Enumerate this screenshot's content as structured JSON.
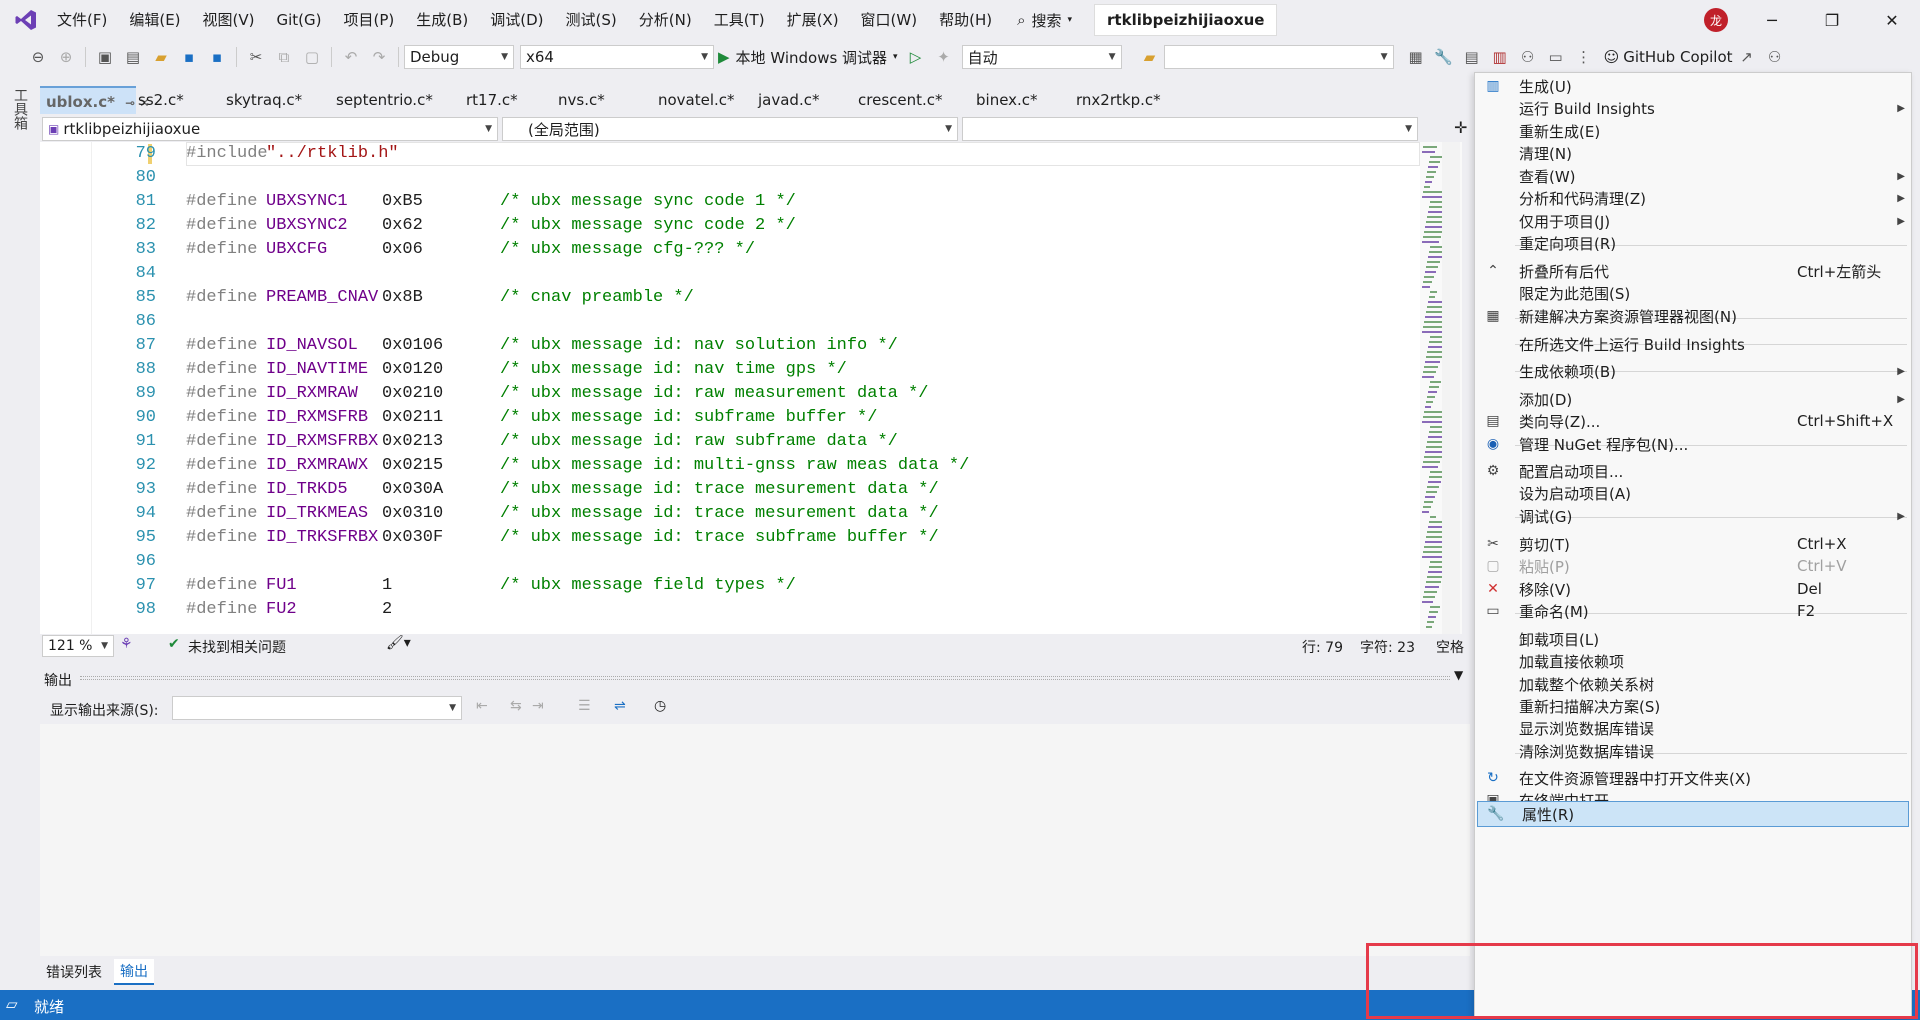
{
  "menubar": {
    "items": [
      "文件(F)",
      "编辑(E)",
      "视图(V)",
      "Git(G)",
      "项目(P)",
      "生成(B)",
      "调试(D)",
      "测试(S)",
      "分析(N)",
      "工具(T)",
      "扩展(X)",
      "窗口(W)",
      "帮助(H)"
    ],
    "search_label": "搜索",
    "solution_name": "rtklibpeizhijiaoxue",
    "avatar": "龙"
  },
  "toolbar": {
    "config": "Debug",
    "platform": "x64",
    "run_label": "本地 Windows 调试器",
    "auto_label": "自动",
    "copilot_label": "GitHub Copilot"
  },
  "left_rail": {
    "label": "工具箱"
  },
  "tabs": [
    "ublox.c*",
    "ss2.c*",
    "skytraq.c*",
    "septentrio.c*",
    "rt17.c*",
    "nvs.c*",
    "novatel.c*",
    "javad.c*",
    "crescent.c*",
    "binex.c*",
    "rnx2rtkp.c*"
  ],
  "nav": {
    "project": "rtklibpeizhijiaoxue",
    "scope": "(全局范围)",
    "member": ""
  },
  "code_lines": [
    {
      "n": "79",
      "kw": "#include",
      "mac": "",
      "val": "",
      "str": "\"../rtklib.h\"",
      "cm": ""
    },
    {
      "n": "80",
      "kw": "",
      "mac": "",
      "val": "",
      "str": "",
      "cm": ""
    },
    {
      "n": "81",
      "kw": "#define",
      "mac": "UBXSYNC1",
      "val": "0xB5",
      "str": "",
      "cm": "/* ubx message sync code 1 */"
    },
    {
      "n": "82",
      "kw": "#define",
      "mac": "UBXSYNC2",
      "val": "0x62",
      "str": "",
      "cm": "/* ubx message sync code 2 */"
    },
    {
      "n": "83",
      "kw": "#define",
      "mac": "UBXCFG",
      "val": "0x06",
      "str": "",
      "cm": "/* ubx message cfg-??? */"
    },
    {
      "n": "84",
      "kw": "",
      "mac": "",
      "val": "",
      "str": "",
      "cm": ""
    },
    {
      "n": "85",
      "kw": "#define",
      "mac": "PREAMB_CNAV",
      "val": "0x8B",
      "str": "",
      "cm": "/* cnav preamble */"
    },
    {
      "n": "86",
      "kw": "",
      "mac": "",
      "val": "",
      "str": "",
      "cm": ""
    },
    {
      "n": "87",
      "kw": "#define",
      "mac": "ID_NAVSOL",
      "val": "0x0106",
      "str": "",
      "cm": "/* ubx message id: nav solution info */"
    },
    {
      "n": "88",
      "kw": "#define",
      "mac": "ID_NAVTIME",
      "val": "0x0120",
      "str": "",
      "cm": "/* ubx message id: nav time gps */"
    },
    {
      "n": "89",
      "kw": "#define",
      "mac": "ID_RXMRAW",
      "val": "0x0210",
      "str": "",
      "cm": "/* ubx message id: raw measurement data */"
    },
    {
      "n": "90",
      "kw": "#define",
      "mac": "ID_RXMSFRB",
      "val": "0x0211",
      "str": "",
      "cm": "/* ubx message id: subframe buffer */"
    },
    {
      "n": "91",
      "kw": "#define",
      "mac": "ID_RXMSFRBX",
      "val": "0x0213",
      "str": "",
      "cm": "/* ubx message id: raw subframe data */"
    },
    {
      "n": "92",
      "kw": "#define",
      "mac": "ID_RXMRAWX",
      "val": "0x0215",
      "str": "",
      "cm": "/* ubx message id: multi-gnss raw meas data */"
    },
    {
      "n": "93",
      "kw": "#define",
      "mac": "ID_TRKD5",
      "val": "0x030A",
      "str": "",
      "cm": "/* ubx message id: trace mesurement data */"
    },
    {
      "n": "94",
      "kw": "#define",
      "mac": "ID_TRKMEAS",
      "val": "0x0310",
      "str": "",
      "cm": "/* ubx message id: trace mesurement data */"
    },
    {
      "n": "95",
      "kw": "#define",
      "mac": "ID_TRKSFRBX",
      "val": "0x030F",
      "str": "",
      "cm": "/* ubx message id: trace subframe buffer */"
    },
    {
      "n": "96",
      "kw": "",
      "mac": "",
      "val": "",
      "str": "",
      "cm": ""
    },
    {
      "n": "97",
      "kw": "#define",
      "mac": "FU1",
      "val": "1",
      "str": "",
      "cm": "/* ubx message field types */"
    },
    {
      "n": "98",
      "kw": "#define",
      "mac": "FU2",
      "val": "2",
      "str": "",
      "cm": ""
    }
  ],
  "editor_status": {
    "zoom": "121 %",
    "issues": "未找到相关问题",
    "line": "行: 79",
    "col": "字符: 23",
    "ws": "空格"
  },
  "output": {
    "title": "输出",
    "source_label": "显示输出来源(S):",
    "source_value": ""
  },
  "bottom_tabs": [
    "错误列表",
    "输出"
  ],
  "statusbar": {
    "text": "就绪"
  },
  "context_menu": [
    {
      "label": "生成(U)",
      "shortcut": "",
      "sub": false,
      "icon": "build-icon"
    },
    {
      "label": "运行 Build Insights",
      "shortcut": "",
      "sub": true,
      "icon": ""
    },
    {
      "label": "重新生成(E)",
      "shortcut": "",
      "sub": false,
      "icon": ""
    },
    {
      "label": "清理(N)",
      "shortcut": "",
      "sub": false,
      "icon": ""
    },
    {
      "label": "查看(W)",
      "shortcut": "",
      "sub": true,
      "icon": ""
    },
    {
      "label": "分析和代码清理(Z)",
      "shortcut": "",
      "sub": true,
      "icon": ""
    },
    {
      "label": "仅用于项目(J)",
      "shortcut": "",
      "sub": true,
      "icon": ""
    },
    {
      "label": "重定向项目(R)",
      "shortcut": "",
      "sub": false,
      "icon": ""
    },
    {
      "label": "折叠所有后代",
      "shortcut": "Ctrl+左箭头",
      "sub": false,
      "icon": "collapse-icon"
    },
    {
      "label": "限定为此范围(S)",
      "shortcut": "",
      "sub": false,
      "icon": ""
    },
    {
      "label": "新建解决方案资源管理器视图(N)",
      "shortcut": "",
      "sub": false,
      "icon": "new-view-icon"
    },
    {
      "label": "在所选文件上运行 Build Insights",
      "shortcut": "",
      "sub": false,
      "icon": ""
    },
    {
      "label": "生成依赖项(B)",
      "shortcut": "",
      "sub": true,
      "icon": ""
    },
    {
      "label": "添加(D)",
      "shortcut": "",
      "sub": true,
      "icon": ""
    },
    {
      "label": "类向导(Z)...",
      "shortcut": "Ctrl+Shift+X",
      "sub": false,
      "icon": "class-wizard-icon"
    },
    {
      "label": "管理 NuGet 程序包(N)...",
      "shortcut": "",
      "sub": false,
      "icon": "nuget-icon"
    },
    {
      "label": "配置启动项目...",
      "shortcut": "",
      "sub": false,
      "icon": "gear-icon"
    },
    {
      "label": "设为启动项目(A)",
      "shortcut": "",
      "sub": false,
      "icon": ""
    },
    {
      "label": "调试(G)",
      "shortcut": "",
      "sub": true,
      "icon": ""
    },
    {
      "label": "剪切(T)",
      "shortcut": "Ctrl+X",
      "sub": false,
      "icon": "cut-icon"
    },
    {
      "label": "粘贴(P)",
      "shortcut": "Ctrl+V",
      "sub": false,
      "icon": "paste-icon",
      "disabled": true
    },
    {
      "label": "移除(V)",
      "shortcut": "Del",
      "sub": false,
      "icon": "remove-icon"
    },
    {
      "label": "重命名(M)",
      "shortcut": "F2",
      "sub": false,
      "icon": "rename-icon"
    },
    {
      "label": "卸载项目(L)",
      "shortcut": "",
      "sub": false,
      "icon": ""
    },
    {
      "label": "加载直接依赖项",
      "shortcut": "",
      "sub": false,
      "icon": ""
    },
    {
      "label": "加载整个依赖关系树",
      "shortcut": "",
      "sub": false,
      "icon": ""
    },
    {
      "label": "重新扫描解决方案(S)",
      "shortcut": "",
      "sub": false,
      "icon": ""
    },
    {
      "label": "显示浏览数据库错误",
      "shortcut": "",
      "sub": false,
      "icon": ""
    },
    {
      "label": "清除浏览数据库错误",
      "shortcut": "",
      "sub": false,
      "icon": ""
    },
    {
      "label": "在文件资源管理器中打开文件夹(X)",
      "shortcut": "",
      "sub": false,
      "icon": "open-folder-icon"
    },
    {
      "label": "在终端中打开",
      "shortcut": "",
      "sub": false,
      "icon": "terminal-icon"
    },
    {
      "label": "属性(R)",
      "shortcut": "",
      "sub": false,
      "icon": "wrench-icon",
      "selected": true
    }
  ],
  "colors": {
    "accent": "#1a6fc4",
    "highlight_box": "#e53a4a",
    "selected_bg": "#cce4f7"
  }
}
